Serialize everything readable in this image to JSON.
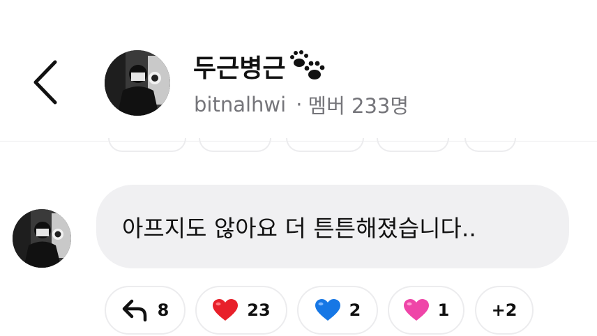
{
  "header": {
    "group_name": "두근병근",
    "handle": "bitnalhwi",
    "separator": "·",
    "member_count": "멤버 233명",
    "title_icon": "paw-prints-icon",
    "back_icon": "chevron-left-icon"
  },
  "message": {
    "text": "아프지도 않아요 더 튼튼해졌습니다.."
  },
  "reactions": [
    {
      "icon": "reply-arrow-icon",
      "count": "8"
    },
    {
      "icon": "red-heart-icon",
      "count": "23",
      "color": "#e8202a"
    },
    {
      "icon": "blue-heart-icon",
      "count": "2",
      "color": "#1677e5"
    },
    {
      "icon": "pink-heart-icon",
      "count": "1",
      "color": "#ef45a8"
    },
    {
      "icon": "more-reactions",
      "count": "+2"
    }
  ]
}
